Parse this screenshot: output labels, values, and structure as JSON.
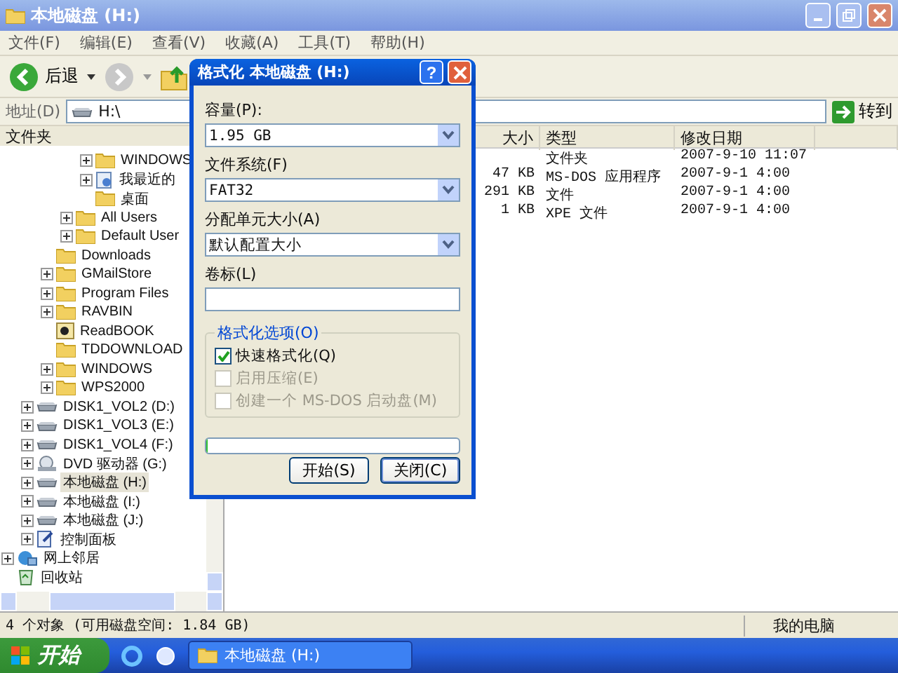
{
  "window": {
    "title": "本地磁盘 (H:)",
    "active": false
  },
  "menu": [
    "文件(F)",
    "编辑(E)",
    "查看(V)",
    "收藏(A)",
    "工具(T)",
    "帮助(H)"
  ],
  "toolbar": {
    "back_label": "后退"
  },
  "address": {
    "label": "地址(D)",
    "value": "H:\\",
    "go_label": "转到"
  },
  "tree": {
    "header": "文件夹",
    "items": [
      {
        "children": [
          {
            "children": [
              {
                "children": [
                  {
                    "children": [
                      {
                        "label": "WINDOWS",
                        "kind": "folder",
                        "expandable": true,
                        "selected": false
                      },
                      {
                        "label": "我最近的",
                        "kind": "recent",
                        "expandable": true,
                        "selected": false
                      },
                      {
                        "label": "桌面",
                        "kind": "folder",
                        "expandable": false,
                        "selected": false
                      }
                    ]
                  },
                  {
                    "label": "All Users",
                    "kind": "folder",
                    "expandable": true,
                    "selected": false
                  },
                  {
                    "label": "Default User",
                    "kind": "folder",
                    "expandable": true,
                    "selected": false
                  }
                ]
              },
              {
                "label": "Downloads",
                "kind": "folder",
                "expandable": false,
                "selected": false
              },
              {
                "label": "GMailStore",
                "kind": "folder",
                "expandable": true,
                "selected": false
              },
              {
                "label": "Program Files",
                "kind": "folder",
                "expandable": true,
                "selected": false
              },
              {
                "label": "RAVBIN",
                "kind": "folder",
                "expandable": true,
                "selected": false
              },
              {
                "label": "ReadBOOK",
                "kind": "app",
                "expandable": false,
                "selected": false
              },
              {
                "label": "TDDOWNLOAD",
                "kind": "folder",
                "expandable": false,
                "selected": false
              },
              {
                "label": "WINDOWS",
                "kind": "folder",
                "expandable": true,
                "selected": false
              },
              {
                "label": "WPS2000",
                "kind": "folder",
                "expandable": true,
                "selected": false
              }
            ]
          },
          {
            "label": "DISK1_VOL2 (D:)",
            "kind": "drive",
            "expandable": true,
            "selected": false
          },
          {
            "label": "DISK1_VOL3 (E:)",
            "kind": "drive",
            "expandable": true,
            "selected": false
          },
          {
            "label": "DISK1_VOL4 (F:)",
            "kind": "drive",
            "expandable": true,
            "selected": false
          },
          {
            "label": "DVD 驱动器 (G:)",
            "kind": "dvd",
            "expandable": true,
            "selected": false
          },
          {
            "label": "本地磁盘 (H:)",
            "kind": "drive",
            "expandable": true,
            "selected": true
          },
          {
            "label": "本地磁盘 (I:)",
            "kind": "drive",
            "expandable": true,
            "selected": false
          },
          {
            "label": "本地磁盘 (J:)",
            "kind": "drive",
            "expandable": true,
            "selected": false
          },
          {
            "label": "控制面板",
            "kind": "control",
            "expandable": true,
            "selected": false
          }
        ]
      },
      {
        "label": "网上邻居",
        "kind": "network",
        "expandable": true,
        "selected": false
      },
      {
        "label": "回收站",
        "kind": "recycle",
        "expandable": false,
        "selected": false
      }
    ]
  },
  "list": {
    "columns": [
      "大小",
      "类型",
      "修改日期"
    ],
    "rows": [
      {
        "size": "",
        "type": "文件夹",
        "date": "2007-9-10 11:07"
      },
      {
        "size": "47 KB",
        "type": "MS-DOS 应用程序",
        "date": "2007-9-1 4:00"
      },
      {
        "size": "291 KB",
        "type": "文件",
        "date": "2007-9-1 4:00"
      },
      {
        "size": "1 KB",
        "type": "XPE 文件",
        "date": "2007-9-1 4:00"
      }
    ]
  },
  "dialog": {
    "title": "格式化 本地磁盘 (H:)",
    "fields": [
      {
        "kind": "select",
        "label": "容量(P):",
        "value": "1.95 GB"
      },
      {
        "kind": "select",
        "label": "文件系统(F)",
        "value": "FAT32"
      },
      {
        "kind": "select",
        "label": "分配单元大小(A)",
        "value": "默认配置大小"
      },
      {
        "kind": "input",
        "label": "卷标(L)"
      }
    ],
    "help_label": "?",
    "options_title": "格式化选项(O)",
    "options": [
      {
        "label": "快速格式化(Q)",
        "checked": true,
        "disabled": false
      },
      {
        "label": "启用压缩(E)",
        "checked": false,
        "disabled": true
      },
      {
        "label": "创建一个 MS-DOS 启动盘(M)",
        "checked": false,
        "disabled": true
      }
    ],
    "progress": {
      "level": 0
    },
    "buttons": [
      "开始(S)",
      "关闭(C)"
    ]
  },
  "status_bar": {
    "text": "4 个对象 (可用磁盘空间: 1.84 GB)",
    "zone": "我的电脑"
  },
  "taskbar": {
    "start": "开始",
    "tasks": [
      {
        "label": "本地磁盘 (H:)",
        "selected": false
      }
    ]
  }
}
